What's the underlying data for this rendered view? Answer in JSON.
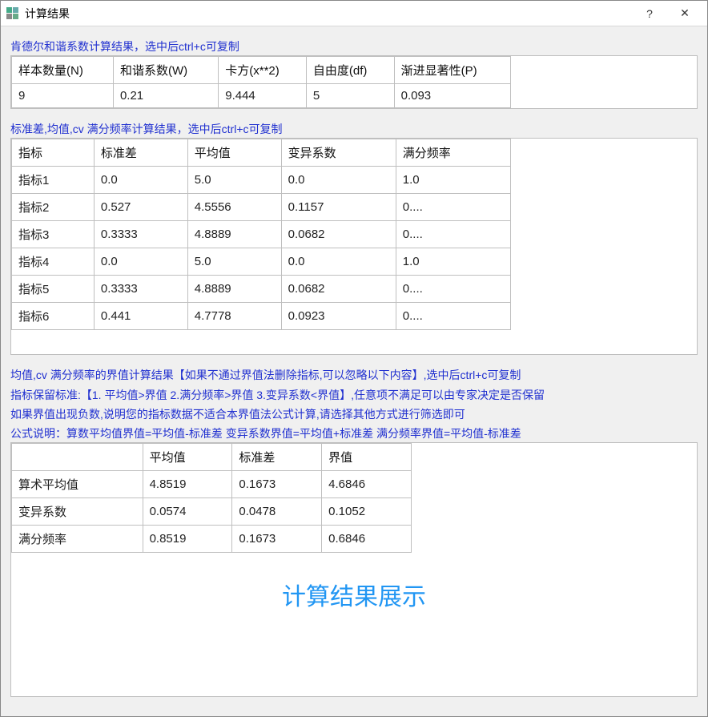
{
  "window": {
    "title": "计算结果",
    "help_icon": "?",
    "close_icon": "✕"
  },
  "section1": {
    "note": "肯德尔和谐系数计算结果，选中后ctrl+c可复制",
    "headers": [
      "样本数量(N)",
      "和谐系数(W)",
      "卡方(x**2)",
      "自由度(df)",
      "渐进显著性(P)"
    ],
    "row": [
      "9",
      "0.21",
      "9.444",
      "5",
      "0.093"
    ]
  },
  "section2": {
    "note": "标准差,均值,cv 满分频率计算结果，选中后ctrl+c可复制",
    "headers": [
      "指标",
      "标准差",
      "平均值",
      "变异系数",
      "满分频率"
    ],
    "rows": [
      [
        "指标1",
        "0.0",
        "5.0",
        "0.0",
        "1.0"
      ],
      [
        "指标2",
        "0.527",
        "4.5556",
        "0.1157",
        "0...."
      ],
      [
        "指标3",
        "0.3333",
        "4.8889",
        "0.0682",
        "0...."
      ],
      [
        "指标4",
        "0.0",
        "5.0",
        "0.0",
        "1.0"
      ],
      [
        "指标5",
        "0.3333",
        "4.8889",
        "0.0682",
        "0...."
      ],
      [
        "指标6",
        "0.441",
        "4.7778",
        "0.0923",
        "0...."
      ]
    ]
  },
  "section3": {
    "note1": "均值,cv 满分频率的界值计算结果【如果不通过界值法删除指标,可以忽略以下内容】,选中后ctrl+c可复制",
    "note2": "指标保留标准:【1. 平均值>界值  2.满分频率>界值  3.变异系数<界值】,任意项不满足可以由专家决定是否保留",
    "note3": "如果界值出现负数,说明您的指标数据不适合本界值法公式计算,请选择其他方式进行筛选即可",
    "note4": "公式说明：算数平均值界值=平均值-标准差   变异系数界值=平均值+标准差  满分频率界值=平均值-标准差",
    "headers": [
      "",
      "平均值",
      "标准差",
      "界值"
    ],
    "rows": [
      [
        "算术平均值",
        "4.8519",
        "0.1673",
        "4.6846"
      ],
      [
        "变异系数",
        "0.0574",
        "0.0478",
        "0.1052"
      ],
      [
        "满分频率",
        "0.8519",
        "0.1673",
        "0.6846"
      ]
    ]
  },
  "footer_label": "计算结果展示"
}
